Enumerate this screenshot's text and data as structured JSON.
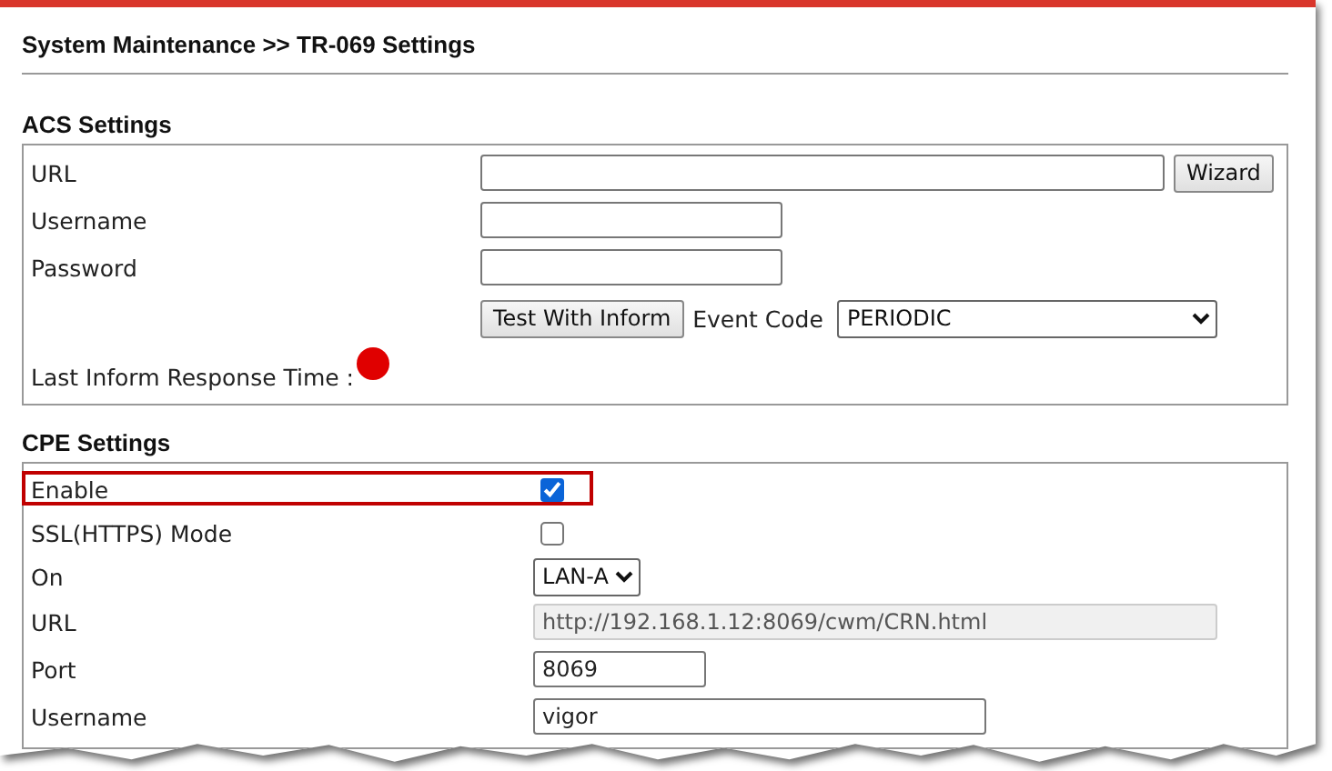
{
  "breadcrumb": "System Maintenance >> TR-069 Settings",
  "sections": [
    {
      "title": "ACS Settings",
      "rows": [
        {
          "kind": "text",
          "label": "URL",
          "value": "",
          "button": "Wizard"
        },
        {
          "kind": "text",
          "label": "Username",
          "value": ""
        },
        {
          "kind": "text",
          "label": "Password",
          "value": ""
        },
        {
          "kind": "action",
          "button": "Test With Inform",
          "select_label": "Event Code",
          "select_value": "PERIODIC"
        },
        {
          "kind": "status",
          "label": "Last Inform Response Time :",
          "color": "#e00000"
        }
      ]
    },
    {
      "title": "CPE Settings",
      "rows": [
        {
          "kind": "checkbox",
          "label": "Enable",
          "checked": true,
          "highlighted": true
        },
        {
          "kind": "checkbox",
          "label": "SSL(HTTPS) Mode",
          "checked": false,
          "highlighted": false
        },
        {
          "kind": "select",
          "label": "On",
          "value": "LAN-A"
        },
        {
          "kind": "text",
          "label": "URL",
          "value": "http://192.168.1.12:8069/cwm/CRN.html",
          "disabled": true
        },
        {
          "kind": "text",
          "label": "Port",
          "value": "8069"
        },
        {
          "kind": "text",
          "label": "Username",
          "value": "vigor"
        }
      ]
    }
  ]
}
